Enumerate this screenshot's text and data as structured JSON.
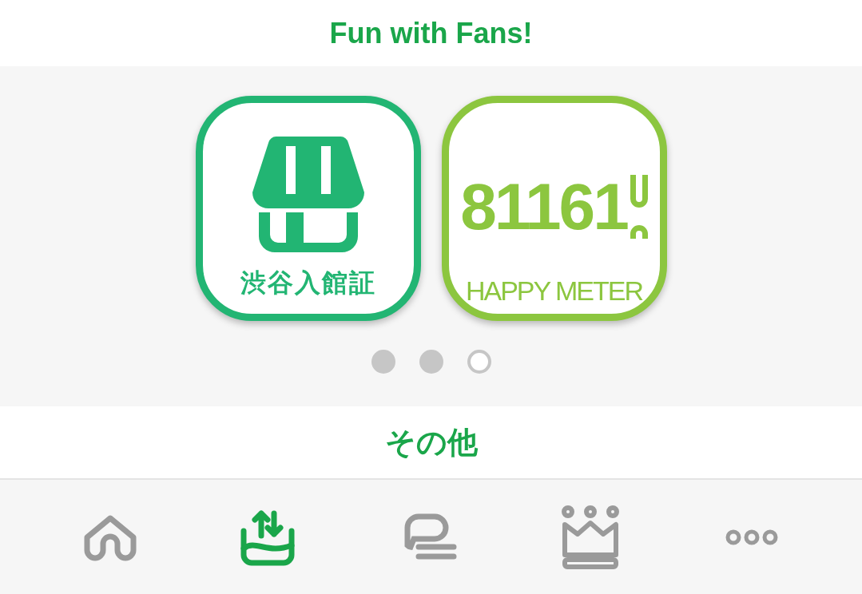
{
  "header": {
    "title": "Fun with Fans!"
  },
  "cards": [
    {
      "kind": "shop",
      "label": "渋谷入館証",
      "color": "#22b573"
    },
    {
      "kind": "meter",
      "value": "81161",
      "label": "HAPPY METER",
      "color": "#8cc63f"
    }
  ],
  "pager": [
    {
      "selected": false
    },
    {
      "selected": false
    },
    {
      "selected": true
    }
  ],
  "section": {
    "title": "その他"
  },
  "nav": [
    {
      "kind": "home",
      "selected": false
    },
    {
      "kind": "exchange",
      "selected": true
    },
    {
      "kind": "chat",
      "selected": false
    },
    {
      "kind": "crown",
      "selected": false
    },
    {
      "kind": "more",
      "selected": false
    }
  ]
}
